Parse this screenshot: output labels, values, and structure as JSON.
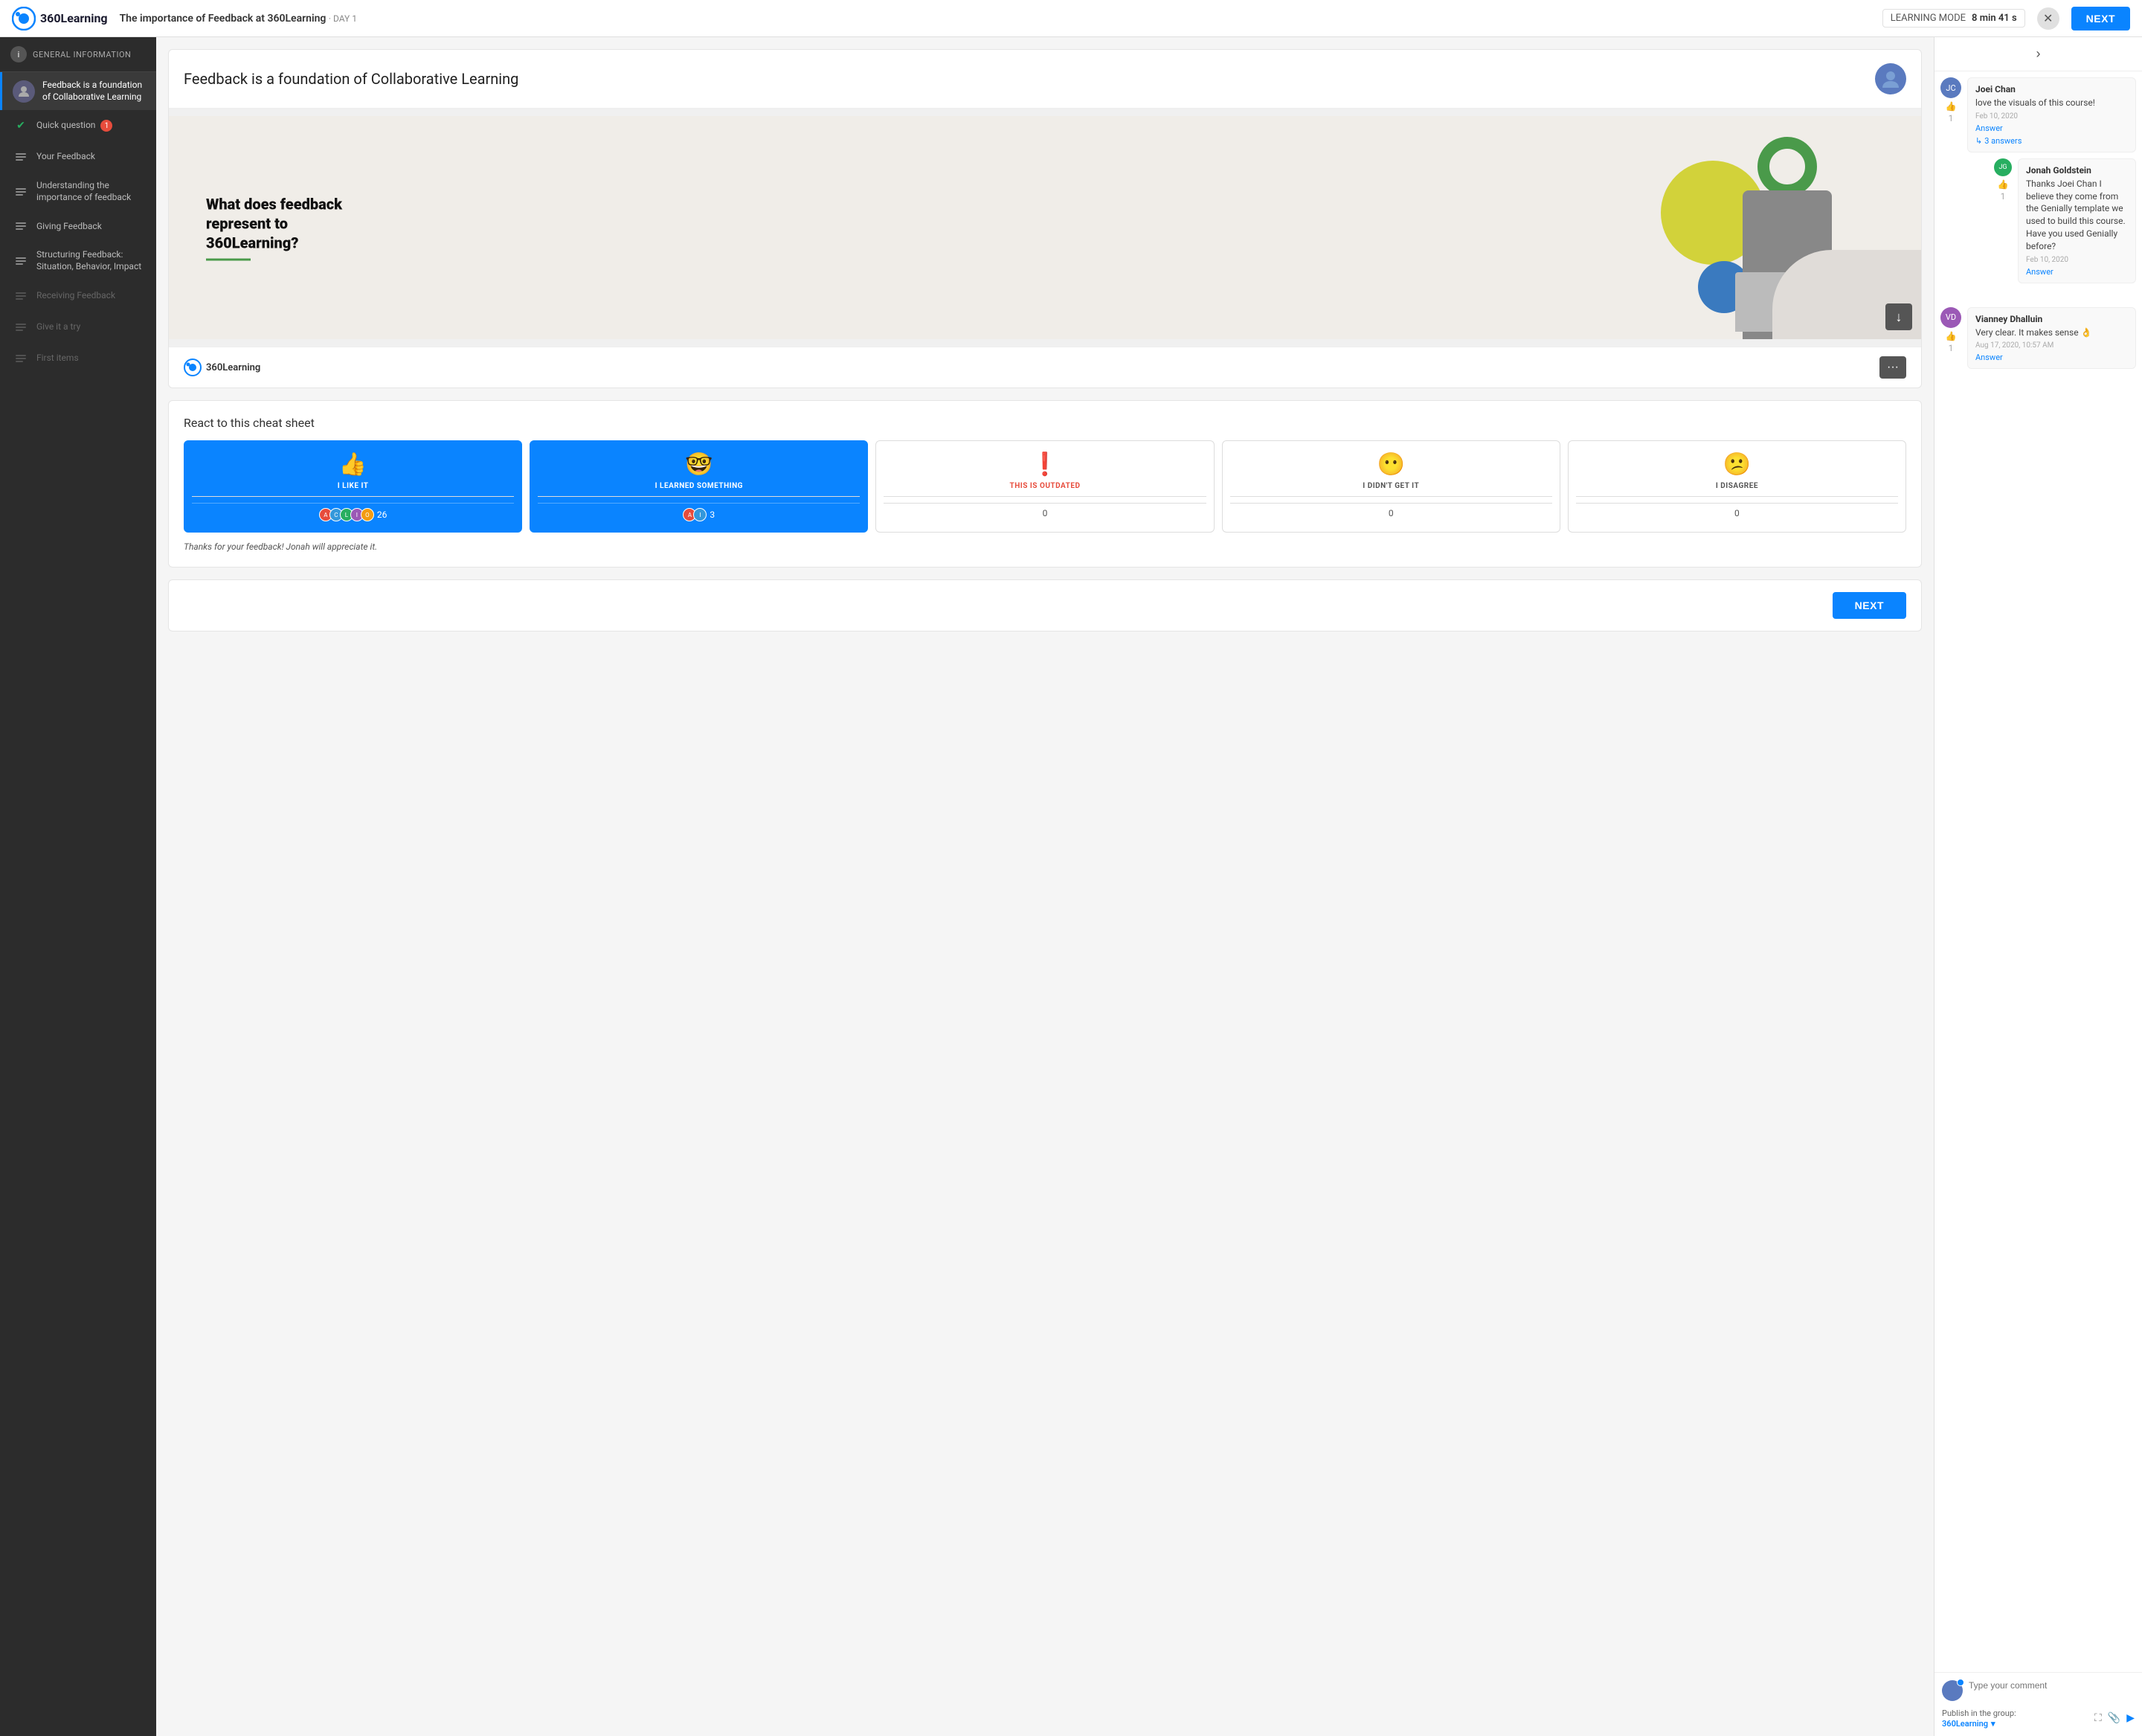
{
  "topbar": {
    "logo_text": "360Learning",
    "course_title": "The importance of Feedback at 360Learning",
    "day_label": "· DAY 1",
    "learning_mode_label": "LEARNING MODE",
    "timer_min": "8",
    "timer_min_label": "min",
    "timer_sec": "41",
    "timer_sec_label": "s",
    "next_label": "NEXT"
  },
  "sidebar": {
    "general_info_label": "GENERAL INFORMATION",
    "items": [
      {
        "id": "feedback-foundation",
        "label": "Feedback is a foundation of Collaborative Learning",
        "active": true,
        "icon": "module-icon"
      },
      {
        "id": "quick-question",
        "label": "Quick question",
        "active": false,
        "icon": "check-icon",
        "badge": "1"
      },
      {
        "id": "your-feedback",
        "label": "Your Feedback",
        "active": false,
        "icon": "module-icon"
      },
      {
        "id": "understanding",
        "label": "Understanding the importance of feedback",
        "active": false,
        "icon": "module-icon"
      },
      {
        "id": "giving-feedback",
        "label": "Giving Feedback",
        "active": false,
        "icon": "module-icon"
      },
      {
        "id": "structuring",
        "label": "Structuring Feedback: Situation, Behavior, Impact",
        "active": false,
        "icon": "module-icon"
      },
      {
        "id": "receiving-feedback",
        "label": "Receiving Feedback",
        "active": false,
        "icon": "module-icon",
        "disabled": true
      },
      {
        "id": "give-it-try",
        "label": "Give it a try",
        "active": false,
        "icon": "module-icon",
        "disabled": true
      },
      {
        "id": "first-items",
        "label": "First items",
        "active": false,
        "icon": "module-icon",
        "disabled": true
      }
    ]
  },
  "content": {
    "title": "Feedback is a foundation of Collaborative Learning",
    "slide_question": "What does feedback represent to 360Learning?",
    "brand": "360Learning",
    "react_title": "React to this cheat sheet"
  },
  "reactions": [
    {
      "id": "like",
      "emoji": "👍",
      "label": "I LIKE IT",
      "count": 26,
      "active": true,
      "has_avatars": true,
      "avatars_count": 5
    },
    {
      "id": "learned",
      "emoji": "🤓",
      "label": "I LEARNED SOMETHING",
      "count": 3,
      "active": true,
      "has_avatars": true,
      "avatars_count": 2
    },
    {
      "id": "outdated",
      "emoji": "❗",
      "label": "THIS IS OUTDATED",
      "count": 0,
      "active": false,
      "has_avatars": false
    },
    {
      "id": "didnt-get",
      "emoji": "😶",
      "label": "I DIDN'T GET IT",
      "count": 0,
      "active": false,
      "has_avatars": false
    },
    {
      "id": "disagree",
      "emoji": "😕",
      "label": "I DISAGREE",
      "count": 0,
      "active": false,
      "has_avatars": false
    }
  ],
  "thanks_message": "Thanks for your feedback! Jonah will appreciate it.",
  "next_label": "NEXT",
  "comments": {
    "expand_icon": "›",
    "items": [
      {
        "id": "comment-1",
        "author": "Joei Chan",
        "avatar_initials": "JC",
        "text": "love the visuals of this course!",
        "date": "Feb 10, 2020",
        "likes": 1,
        "answers_count": 3,
        "answers_label": "3 answers",
        "sub_comments": [
          {
            "id": "sub-1",
            "author": "Jonah Goldstein",
            "avatar_initials": "JG",
            "text": "Thanks Joei Chan I believe they come from the Genially template we used to build this course. Have you used Genially before?",
            "date": "Feb 10, 2020",
            "likes": 1
          }
        ]
      },
      {
        "id": "comment-2",
        "author": "Vianney Dhalluin",
        "avatar_initials": "VD",
        "text": "Very clear. It makes sense 👌",
        "date": "Aug 17, 2020, 10:57 AM",
        "likes": 1,
        "answers_count": 0
      }
    ],
    "input_placeholder": "Type your comment",
    "publish_label": "Publish in the group:",
    "publish_group": "360Learning"
  }
}
